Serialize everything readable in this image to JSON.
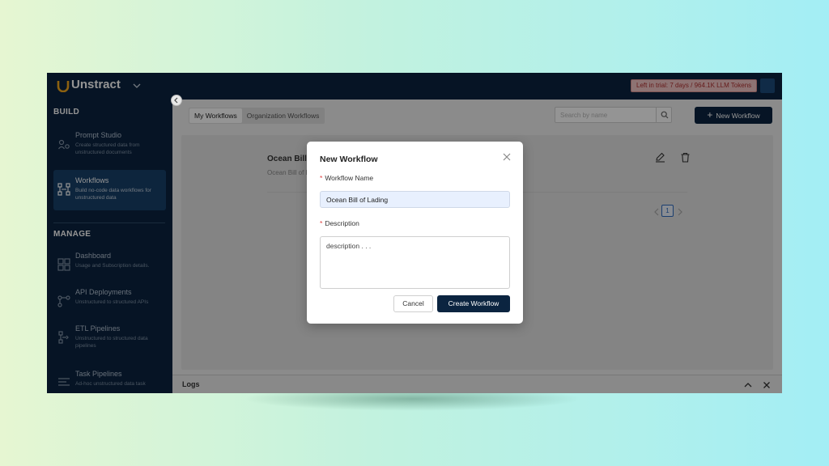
{
  "brand": {
    "name": "Unstract"
  },
  "topbar": {
    "trial_text": "Left in trial: 7 days / 964.1K LLM Tokens"
  },
  "sidebar": {
    "build_title": "BUILD",
    "manage_title": "MANAGE",
    "build_items": [
      {
        "title": "Prompt Studio",
        "desc": "Create structured data from unstructured documents",
        "icon": "prompt-studio-icon"
      },
      {
        "title": "Workflows",
        "desc": "Build no-code data workflows for unstructured data",
        "icon": "workflow-icon",
        "active": true
      }
    ],
    "manage_items": [
      {
        "title": "Dashboard",
        "desc": "Usage and Subscription details.",
        "icon": "dashboard-icon"
      },
      {
        "title": "API Deployments",
        "desc": "Unstructured to structured APIs",
        "icon": "api-icon"
      },
      {
        "title": "ETL Pipelines",
        "desc": "Unstructured to structured data pipelines",
        "icon": "etl-icon"
      },
      {
        "title": "Task Pipelines",
        "desc": "Ad-hoc unstructured data task",
        "icon": "task-icon"
      }
    ]
  },
  "main": {
    "tabs": [
      {
        "label": "My Workflows",
        "active": true
      },
      {
        "label": "Organization Workflows"
      }
    ],
    "search_placeholder": "Search by name",
    "new_workflow_label": "New Workflow",
    "new_workflow_plus": "+",
    "workflow": {
      "title": "Ocean Bill of Lading",
      "desc": "Ocean Bill of Lading"
    },
    "pager": {
      "current": "1"
    },
    "logs_title": "Logs"
  },
  "modal": {
    "title": "New Workflow",
    "required_mark": "*",
    "name_label": "Workflow Name",
    "name_value": "Ocean Bill of Lading",
    "desc_label": "Description",
    "desc_placeholder": "description . . .",
    "cancel_label": "Cancel",
    "create_label": "Create Workflow"
  },
  "colors": {
    "navy": "#0b2440",
    "active_nav": "#17406a",
    "accent_blue": "#2f6cc0",
    "required": "#e04040"
  }
}
